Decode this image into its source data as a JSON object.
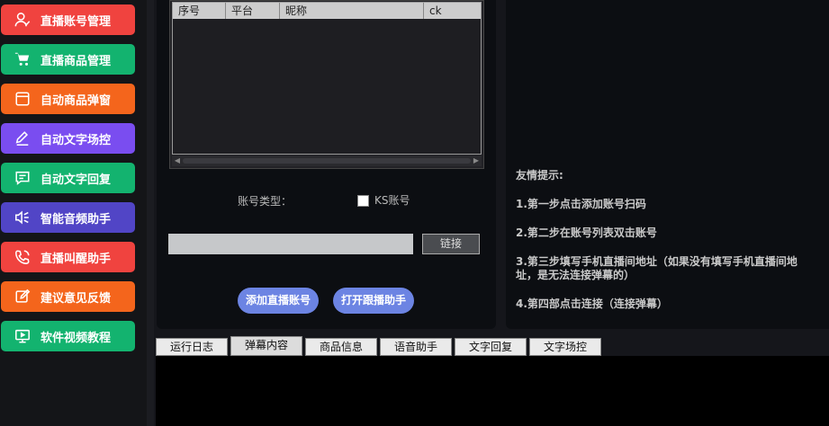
{
  "sidebar": {
    "items": [
      {
        "label": "直播账号管理",
        "color": "#f0433f",
        "icon": "user-icon"
      },
      {
        "label": "直播商品管理",
        "color": "#13b36f",
        "icon": "cart-icon"
      },
      {
        "label": "自动商品弹窗",
        "color": "#f4651c",
        "icon": "window-icon"
      },
      {
        "label": "自动文字场控",
        "color": "#7a4df0",
        "icon": "pen-icon"
      },
      {
        "label": "自动文字回复",
        "color": "#13b36f",
        "icon": "chat-icon"
      },
      {
        "label": "智能音频助手",
        "color": "#5145c6",
        "icon": "speaker-icon"
      },
      {
        "label": "直播叫醒助手",
        "color": "#f0433f",
        "icon": "phone-icon"
      },
      {
        "label": "建议意见反馈",
        "color": "#f4651c",
        "icon": "edit-icon"
      },
      {
        "label": "软件视频教程",
        "color": "#13b36f",
        "icon": "monitor-icon"
      }
    ]
  },
  "account_table": {
    "columns": [
      "序号",
      "平台",
      "昵称",
      "ck"
    ]
  },
  "account_type": {
    "label": "账号类型：",
    "option_label": "KS账号",
    "checked": false
  },
  "link": {
    "value": "",
    "button_label": "链接"
  },
  "actions": {
    "add_account": "添加直播账号",
    "open_helper": "打开跟播助手"
  },
  "tips": {
    "title": "友情提示:",
    "step1": "1.第一步点击添加账号扫码",
    "step2": "2.第二步在账号列表双击账号",
    "step3_line1": "3.第三步填写手机直播间地址（如果没有填写手机直播间地",
    "step3_line2": "址，是无法连接弹幕的）",
    "step4": "4.第四部点击连接（连接弹幕）"
  },
  "tabs": [
    {
      "label": "运行日志"
    },
    {
      "label": "弹幕内容",
      "active": true
    },
    {
      "label": "商品信息"
    },
    {
      "label": "语音助手"
    },
    {
      "label": "文字回复"
    },
    {
      "label": "文字场控"
    }
  ]
}
